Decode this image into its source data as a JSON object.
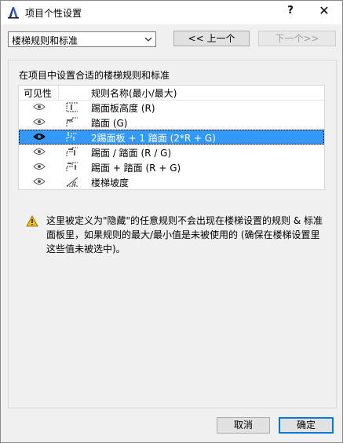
{
  "window": {
    "title": "项目个性设置",
    "help": "?",
    "close": "✕"
  },
  "toolbar": {
    "category_value": "楼梯规则和标准",
    "prev_label": "<< 上一个",
    "next_label": "下一个>>"
  },
  "section": {
    "label": "在项目中设置合适的楼梯规则和标准"
  },
  "table": {
    "columns": [
      "可见性",
      "规则名称(最小/最大)"
    ],
    "rows": [
      {
        "label": "踢面板高度 (R)",
        "icon": "riser-height-icon",
        "selected": false
      },
      {
        "label": "踏面 (G)",
        "icon": "tread-icon",
        "selected": false
      },
      {
        "label": "2踢面板 + 1 踏面 (2*R + G)",
        "icon": "two-riser-tread-icon",
        "selected": true
      },
      {
        "label": "踢面 / 踏面 (R / G)",
        "icon": "riser-over-tread-icon",
        "selected": false
      },
      {
        "label": "踢面 + 踏面 (R + G)",
        "icon": "riser-plus-tread-icon",
        "selected": false
      },
      {
        "label": "楼梯坡度",
        "icon": "stair-slope-icon",
        "selected": false
      }
    ]
  },
  "notice": {
    "text": "这里被定义为\"隐藏\"的任意规则不会出现在楼梯设置的规则 & 标准面板里，如果规则的最大/最小值是未被使用的 (确保在楼梯设置里这些值未被选中)。"
  },
  "footer": {
    "cancel_label": "取消",
    "ok_label": "确定"
  },
  "colors": {
    "selection": "#3399ff",
    "accent": "#0078d7",
    "warning": "#f2c200"
  }
}
